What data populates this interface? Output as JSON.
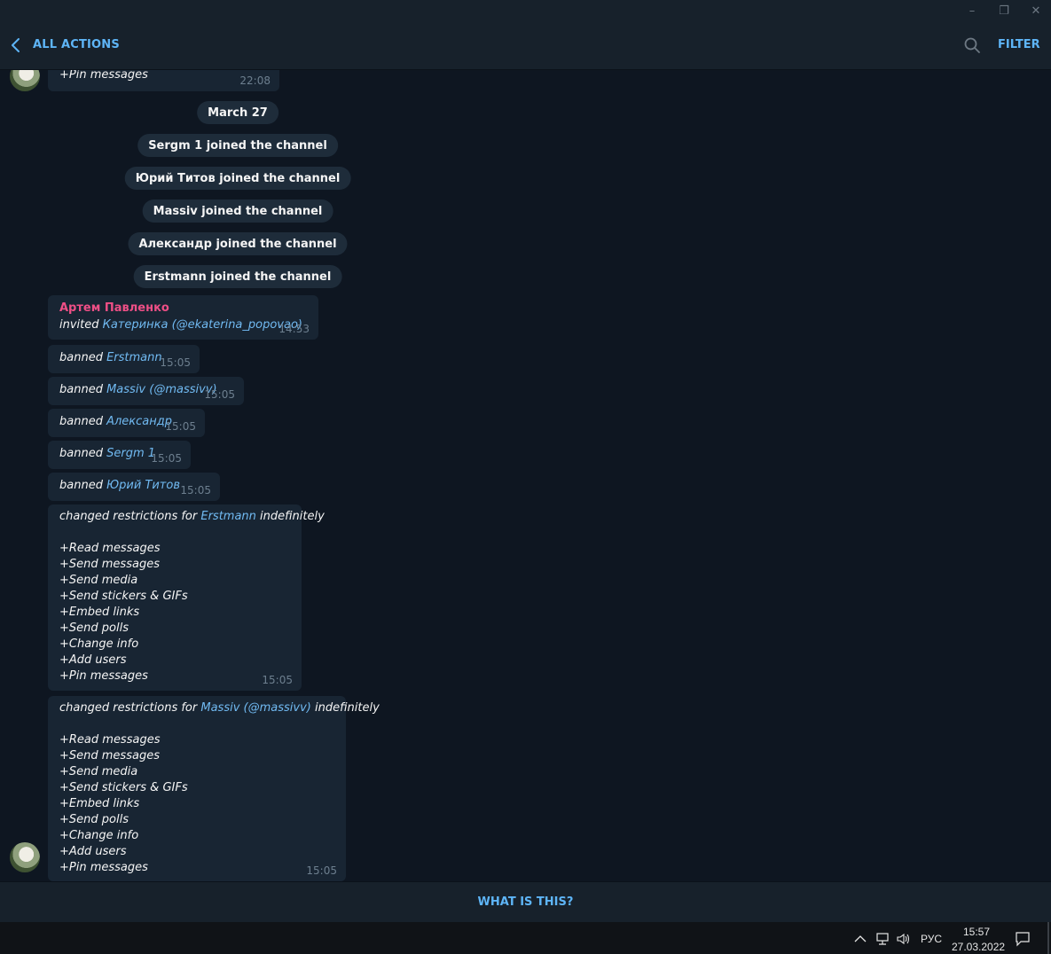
{
  "window": {
    "min": "–",
    "restore": "❐",
    "close": "✕"
  },
  "header": {
    "back_label": "ALL ACTIONS",
    "filter_label": "FILTER"
  },
  "top_partial": {
    "text": "+Pin messages",
    "time": "22:08"
  },
  "date_separator": "March 27",
  "joins": [
    "Sergm 1 joined the channel",
    "Юрий Титов joined the channel",
    "Massiv joined the channel",
    "Александр joined the channel",
    "Erstmann joined the channel"
  ],
  "invite": {
    "author": "Артем Павленко",
    "prefix": "invited ",
    "name": "Катеринка",
    "handle": "(@ekaterina_popovao)",
    "time": "14:53"
  },
  "bans": [
    {
      "prefix": "banned ",
      "name": "Erstmann",
      "time": "15:05"
    },
    {
      "prefix": "banned ",
      "name": "Massiv",
      "handle": "(@massivv)",
      "time": "15:05"
    },
    {
      "prefix": "banned ",
      "name": "Александр",
      "time": "15:05"
    },
    {
      "prefix": "banned ",
      "name": "Sergm 1",
      "time": "15:05"
    },
    {
      "prefix": "banned ",
      "name": "Юрий Титов",
      "time": "15:05"
    }
  ],
  "restrictions": [
    {
      "prefix": "changed restrictions for ",
      "name": "Erstmann",
      "suffix": " indefinitely",
      "items": [
        "+Read messages",
        "+Send messages",
        "+Send media",
        "+Send stickers & GIFs",
        "+Embed links",
        "+Send polls",
        "+Change info",
        "+Add users",
        "+Pin messages"
      ],
      "time": "15:05"
    },
    {
      "prefix": "changed restrictions for ",
      "name": "Massiv",
      "handle": "(@massivv)",
      "suffix": " indefinitely",
      "items": [
        "+Read messages",
        "+Send messages",
        "+Send media",
        "+Send stickers & GIFs",
        "+Embed links",
        "+Send polls",
        "+Change info",
        "+Add users",
        "+Pin messages"
      ],
      "time": "15:05"
    }
  ],
  "bottom": {
    "what_label": "WHAT IS THIS?"
  },
  "taskbar": {
    "lang": "РУС",
    "time": "15:57",
    "date": "27.03.2022"
  }
}
